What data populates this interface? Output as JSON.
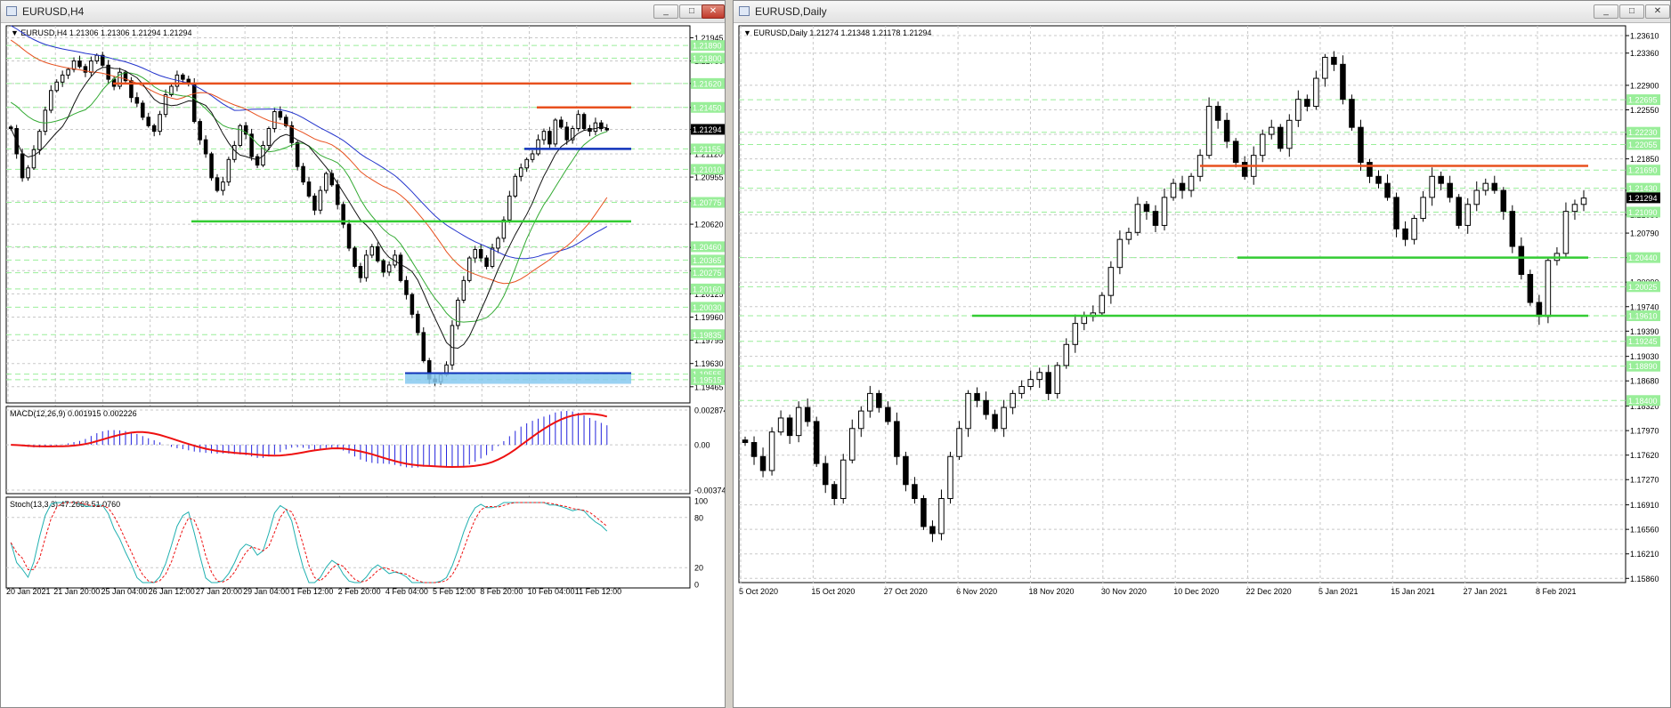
{
  "windows": {
    "left": {
      "title": "EURUSD,H4",
      "buttons": {
        "min": "_",
        "max": "□",
        "close": "✕"
      }
    },
    "right": {
      "title": "EURUSD,Daily",
      "buttons": {
        "min": "_",
        "max": "□",
        "close": "✕"
      }
    }
  },
  "colors": {
    "grid": "#c8c8c8",
    "candle": "#000000",
    "ma_blue": "#2233cc",
    "ma_orange": "#e8501e",
    "ma_green": "#33aa33",
    "ma_black": "#111111",
    "level_orange": "#e8501e",
    "level_green": "#33cc33",
    "level_blue": "#1133bb",
    "zone_blue": "#87c9f0",
    "macd_hist": "#2222dd",
    "macd_signal": "#ee1111",
    "stoch_main": "#20b0b0",
    "stoch_signal": "#ee1111",
    "label_green": "#99ee99",
    "price_label": "#000000"
  },
  "chart_data": [
    {
      "type": "candlestick",
      "symbol": "EURUSD",
      "timeframe": "H4",
      "header": "EURUSD,H4  1.21306 1.21306 1.21294 1.21294",
      "ylim": [
        1.1935,
        1.2203
      ],
      "y_ticks": [
        "1.21945",
        "1.21780",
        "1.21620",
        "1.21450",
        "1.21294",
        "1.21120",
        "1.20955",
        "1.20785",
        "1.20620",
        "1.20455",
        "1.20290",
        "1.20125",
        "1.19960",
        "1.19795",
        "1.19630",
        "1.19465"
      ],
      "level_labels": [
        "1.21890",
        "1.21800",
        "1.21620",
        "1.21450",
        "1.21155",
        "1.21010",
        "1.20775",
        "1.20460",
        "1.20365",
        "1.20275",
        "1.20160",
        "1.20030",
        "1.19835",
        "1.19555",
        "1.19515"
      ],
      "current_price": "1.21294",
      "x_labels": [
        "20 Jan 2021",
        "21 Jan 20:00",
        "25 Jan 04:00",
        "26 Jan 12:00",
        "27 Jan 20:00",
        "29 Jan 04:00",
        "1 Feb 12:00",
        "2 Feb 20:00",
        "4 Feb 04:00",
        "5 Feb 12:00",
        "8 Feb 20:00",
        "10 Feb 04:00",
        "11 Feb 12:00"
      ],
      "closes": [
        1.213,
        1.2112,
        1.2095,
        1.2102,
        1.2115,
        1.2128,
        1.2143,
        1.2157,
        1.2163,
        1.2168,
        1.2172,
        1.2178,
        1.2174,
        1.217,
        1.2178,
        1.2182,
        1.2175,
        1.2165,
        1.216,
        1.217,
        1.2164,
        1.2152,
        1.2148,
        1.2138,
        1.2132,
        1.2128,
        1.214,
        1.2154,
        1.216,
        1.2168,
        1.2165,
        1.2162,
        1.2135,
        1.2122,
        1.2112,
        1.2095,
        1.2086,
        1.2092,
        1.2108,
        1.2118,
        1.2132,
        1.2126,
        1.211,
        1.2104,
        1.2118,
        1.213,
        1.2142,
        1.2138,
        1.2132,
        1.212,
        1.2103,
        1.2092,
        1.2082,
        1.2072,
        1.2086,
        1.2098,
        1.209,
        1.2076,
        1.2062,
        1.2045,
        1.2032,
        1.2024,
        1.204,
        1.2046,
        1.2036,
        1.2028,
        1.2033,
        1.204,
        1.2022,
        1.2012,
        1.1998,
        1.1985,
        1.1965,
        1.1952,
        1.195,
        1.1955,
        1.1962,
        1.199,
        1.2008,
        1.2022,
        1.2038,
        1.2044,
        1.2038,
        1.2032,
        1.2045,
        1.2052,
        1.2065,
        1.2082,
        1.2096,
        1.2102,
        1.2108,
        1.2112,
        1.2122,
        1.2128,
        1.2119,
        1.2136,
        1.2131,
        1.2122,
        1.213,
        1.214,
        1.213,
        1.2128,
        1.2134,
        1.213,
        1.2129
      ],
      "levels": [
        {
          "value": 1.2162,
          "color": "orange"
        },
        {
          "value": 1.2145,
          "color": "orange"
        },
        {
          "value": 1.21155,
          "color": "blue"
        },
        {
          "value": 1.2064,
          "color": "green"
        },
        {
          "value": 1.1953,
          "color": "zone"
        }
      ],
      "indicators": {
        "macd": {
          "label": "MACD(12,26,9) 0.001915 0.002226",
          "y_ticks": [
            "0.002874",
            "0.00",
            "-0.003742"
          ],
          "ylim": [
            -0.003742,
            0.002874
          ]
        },
        "stoch": {
          "label": "Stoch(13,3,3) 47.2663 51.0760",
          "y_ticks": [
            "100",
            "80",
            "20",
            "0"
          ],
          "ylim": [
            0,
            100
          ]
        }
      }
    },
    {
      "type": "candlestick",
      "symbol": "EURUSD",
      "timeframe": "Daily",
      "header": "EURUSD,Daily  1.21274 1.21348 1.21178 1.21294",
      "ylim": [
        1.158,
        1.2375
      ],
      "y_ticks": [
        "1.23610",
        "1.23360",
        "1.22900",
        "1.22550",
        "1.22200",
        "1.21850",
        "1.21400",
        "1.21050",
        "1.20790",
        "1.20440",
        "1.20090",
        "1.19740",
        "1.19390",
        "1.19030",
        "1.18680",
        "1.18320",
        "1.17970",
        "1.17620",
        "1.17270",
        "1.16910",
        "1.16560",
        "1.16210",
        "1.15860"
      ],
      "level_labels": [
        "1.22695",
        "1.22230",
        "1.22055",
        "1.21690",
        "1.21430",
        "1.21090",
        "1.20440",
        "1.20025",
        "1.19610",
        "1.19245",
        "1.18890",
        "1.18400"
      ],
      "current_price": "1.21294",
      "x_labels": [
        "5 Oct 2020",
        "15 Oct 2020",
        "27 Oct 2020",
        "6 Nov 2020",
        "18 Nov 2020",
        "30 Nov 2020",
        "10 Dec 2020",
        "22 Dec 2020",
        "5 Jan 2021",
        "15 Jan 2021",
        "27 Jan 2021",
        "8 Feb 2021"
      ],
      "closes": [
        1.178,
        1.176,
        1.174,
        1.1795,
        1.1815,
        1.179,
        1.183,
        1.181,
        1.175,
        1.172,
        1.17,
        1.1755,
        1.18,
        1.1825,
        1.185,
        1.183,
        1.181,
        1.176,
        1.172,
        1.17,
        1.166,
        1.165,
        1.17,
        1.176,
        1.18,
        1.185,
        1.184,
        1.182,
        1.18,
        1.183,
        1.185,
        1.186,
        1.187,
        1.188,
        1.185,
        1.189,
        1.192,
        1.195,
        1.196,
        1.1965,
        1.199,
        1.203,
        1.207,
        1.208,
        1.212,
        1.211,
        1.209,
        1.213,
        1.215,
        1.214,
        1.216,
        1.219,
        1.226,
        1.224,
        1.221,
        1.218,
        1.216,
        1.219,
        1.222,
        1.223,
        1.22,
        1.224,
        1.227,
        1.226,
        1.23,
        1.233,
        1.232,
        1.227,
        1.223,
        1.218,
        1.216,
        1.215,
        1.213,
        1.2085,
        1.207,
        1.21,
        1.213,
        1.216,
        1.215,
        1.213,
        1.209,
        1.212,
        1.214,
        1.215,
        1.214,
        1.211,
        1.206,
        1.202,
        1.198,
        1.196,
        1.204,
        1.205,
        1.211,
        1.212,
        1.2129
      ],
      "levels": [
        {
          "value": 1.2175,
          "color": "orange"
        },
        {
          "value": 1.2044,
          "color": "green"
        },
        {
          "value": 1.1961,
          "color": "green"
        }
      ]
    }
  ]
}
